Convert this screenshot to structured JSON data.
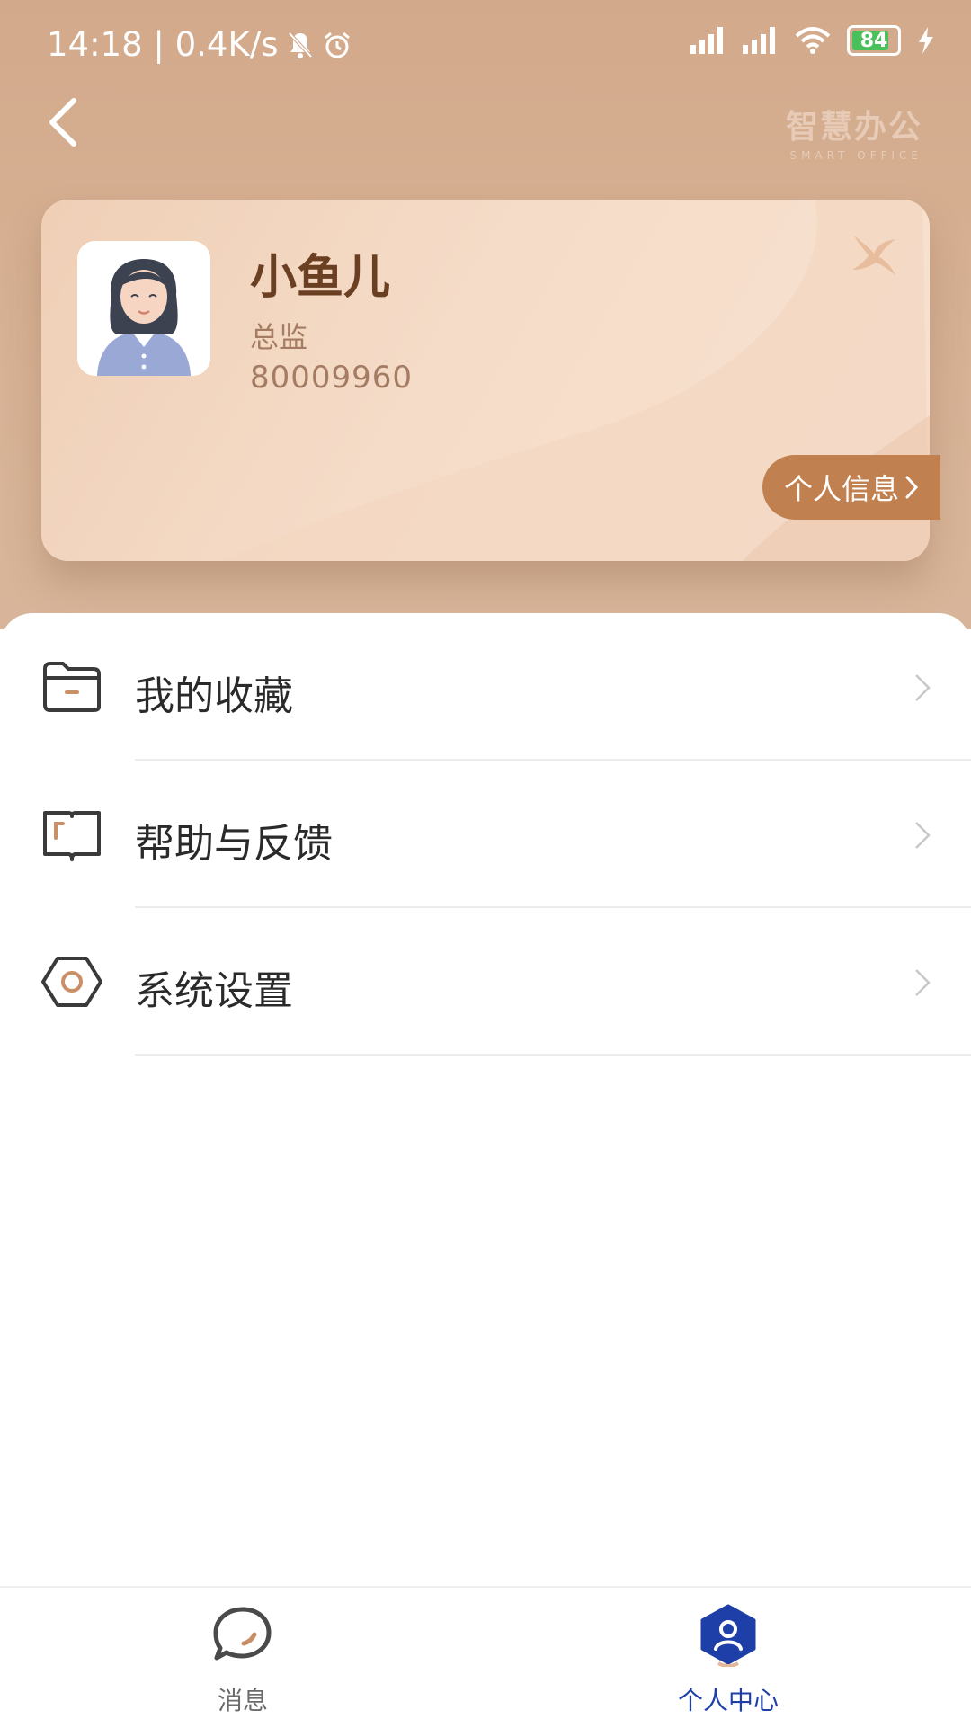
{
  "status_bar": {
    "time_speed": "14:18 | 0.4K/s",
    "battery": "84",
    "battery_level": 0.84
  },
  "header": {
    "brand_cn": "智慧办公",
    "brand_en": "SMART OFFICE"
  },
  "profile": {
    "name": "小鱼儿",
    "title": "总监",
    "id": "80009960",
    "info_button": "个人信息"
  },
  "menu": {
    "items": [
      {
        "label": "我的收藏",
        "icon": "folder-icon"
      },
      {
        "label": "帮助与反馈",
        "icon": "book-icon"
      },
      {
        "label": "系统设置",
        "icon": "settings-hexagon-icon"
      }
    ]
  },
  "tabbar": {
    "tabs": [
      {
        "label": "消息",
        "icon": "chat-bubble-icon",
        "active": false
      },
      {
        "label": "个人中心",
        "icon": "person-hexagon-icon",
        "active": true
      }
    ],
    "active_color": "#1f3fa8",
    "inactive_color": "#6b6b6b"
  },
  "colors": {
    "header_bg": "#d3a98b",
    "accent": "#c0804f",
    "name_color": "#6a3f22"
  }
}
